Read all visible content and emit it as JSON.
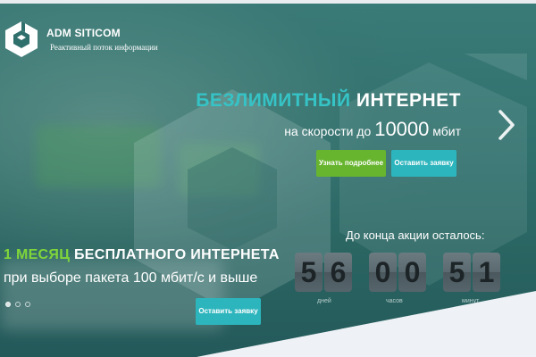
{
  "brand": {
    "name": "ADM SITICOM",
    "tagline": "Реактивный поток информации"
  },
  "slide1": {
    "headline_highlight": "БЕЗЛИМИТНЫЙ",
    "headline_rest": "ИНТЕРНЕТ",
    "sub_prefix": "на скорости до",
    "sub_value": "10000",
    "sub_unit": "мбит",
    "btn_more": "Узнать подробнее",
    "btn_apply": "Оставить заявку"
  },
  "slide2": {
    "title_highlight": "1 МЕСЯЦ",
    "title_rest": "БЕСПЛАТНОГО ИНТЕРНЕТА",
    "subtitle": "при выборе пакета 100 мбит/с и выше",
    "btn_apply": "Оставить заявку"
  },
  "countdown": {
    "title": "До конца акции осталось:",
    "days": [
      "5",
      "6"
    ],
    "hours": [
      "0",
      "0"
    ],
    "minutes": [
      "5",
      "1"
    ],
    "unit_days": "дней",
    "unit_hours": "часов",
    "unit_minutes": "минут"
  },
  "slider": {
    "dot_count": 3,
    "active_index": 0
  },
  "icons": {
    "logo": "cube-logo-icon",
    "next": "chevron-right-icon"
  },
  "colors": {
    "accent_teal": "#36c3c6",
    "accent_green": "#7fd63a",
    "button_green": "#67b52e",
    "button_teal": "#2db5bd"
  }
}
